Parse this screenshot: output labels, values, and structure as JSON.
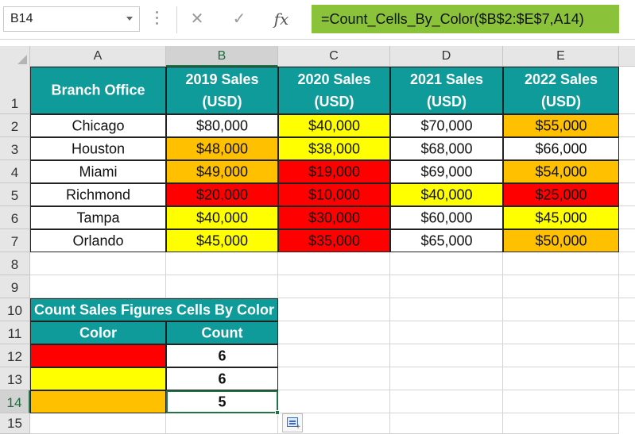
{
  "name_box": "B14",
  "formula": "=Count_Cells_By_Color($B$2:$E$7,A14)",
  "formula_buttons": {
    "cancel": "✕",
    "enter": "✓",
    "fx": "fx"
  },
  "columns": [
    "A",
    "B",
    "C",
    "D",
    "E"
  ],
  "rows": [
    "1",
    "2",
    "3",
    "4",
    "5",
    "6",
    "7",
    "8",
    "9",
    "10",
    "11",
    "12",
    "13",
    "14",
    "15"
  ],
  "colors": {
    "header": "#0F9B99",
    "red": "#FF0000",
    "yellow": "#FFFF00",
    "orange": "#FFC000",
    "white": "#FFFFFF",
    "formula_bg": "#8AC33A"
  },
  "table1": {
    "headers": [
      {
        "l1": "Branch Office",
        "l2": ""
      },
      {
        "l1": "2019 Sales",
        "l2": "(USD)"
      },
      {
        "l1": "2020 Sales",
        "l2": "(USD)"
      },
      {
        "l1": "2021 Sales",
        "l2": "(USD)"
      },
      {
        "l1": "2022 Sales",
        "l2": "(USD)"
      }
    ],
    "rows": [
      {
        "office": "Chicago",
        "sales": [
          {
            "v": "$80,000",
            "c": "white"
          },
          {
            "v": "$40,000",
            "c": "yellow"
          },
          {
            "v": "$70,000",
            "c": "white"
          },
          {
            "v": "$55,000",
            "c": "orange"
          }
        ]
      },
      {
        "office": "Houston",
        "sales": [
          {
            "v": "$48,000",
            "c": "orange"
          },
          {
            "v": "$38,000",
            "c": "yellow"
          },
          {
            "v": "$68,000",
            "c": "white"
          },
          {
            "v": "$66,000",
            "c": "white"
          }
        ]
      },
      {
        "office": "Miami",
        "sales": [
          {
            "v": "$49,000",
            "c": "orange"
          },
          {
            "v": "$19,000",
            "c": "red"
          },
          {
            "v": "$69,000",
            "c": "white"
          },
          {
            "v": "$54,000",
            "c": "orange"
          }
        ]
      },
      {
        "office": "Richmond",
        "sales": [
          {
            "v": "$20,000",
            "c": "red"
          },
          {
            "v": "$10,000",
            "c": "red"
          },
          {
            "v": "$40,000",
            "c": "yellow"
          },
          {
            "v": "$25,000",
            "c": "red"
          }
        ]
      },
      {
        "office": "Tampa",
        "sales": [
          {
            "v": "$40,000",
            "c": "yellow"
          },
          {
            "v": "$30,000",
            "c": "red"
          },
          {
            "v": "$60,000",
            "c": "white"
          },
          {
            "v": "$45,000",
            "c": "yellow"
          }
        ]
      },
      {
        "office": "Orlando",
        "sales": [
          {
            "v": "$45,000",
            "c": "yellow"
          },
          {
            "v": "$35,000",
            "c": "red"
          },
          {
            "v": "$65,000",
            "c": "white"
          },
          {
            "v": "$50,000",
            "c": "orange"
          }
        ]
      }
    ]
  },
  "table2": {
    "title": "Count Sales Figures Cells By Color",
    "color_header": "Color",
    "count_header": "Count",
    "rows": [
      {
        "c": "red",
        "count": "6"
      },
      {
        "c": "yellow",
        "count": "6"
      },
      {
        "c": "orange",
        "count": "5"
      }
    ]
  }
}
